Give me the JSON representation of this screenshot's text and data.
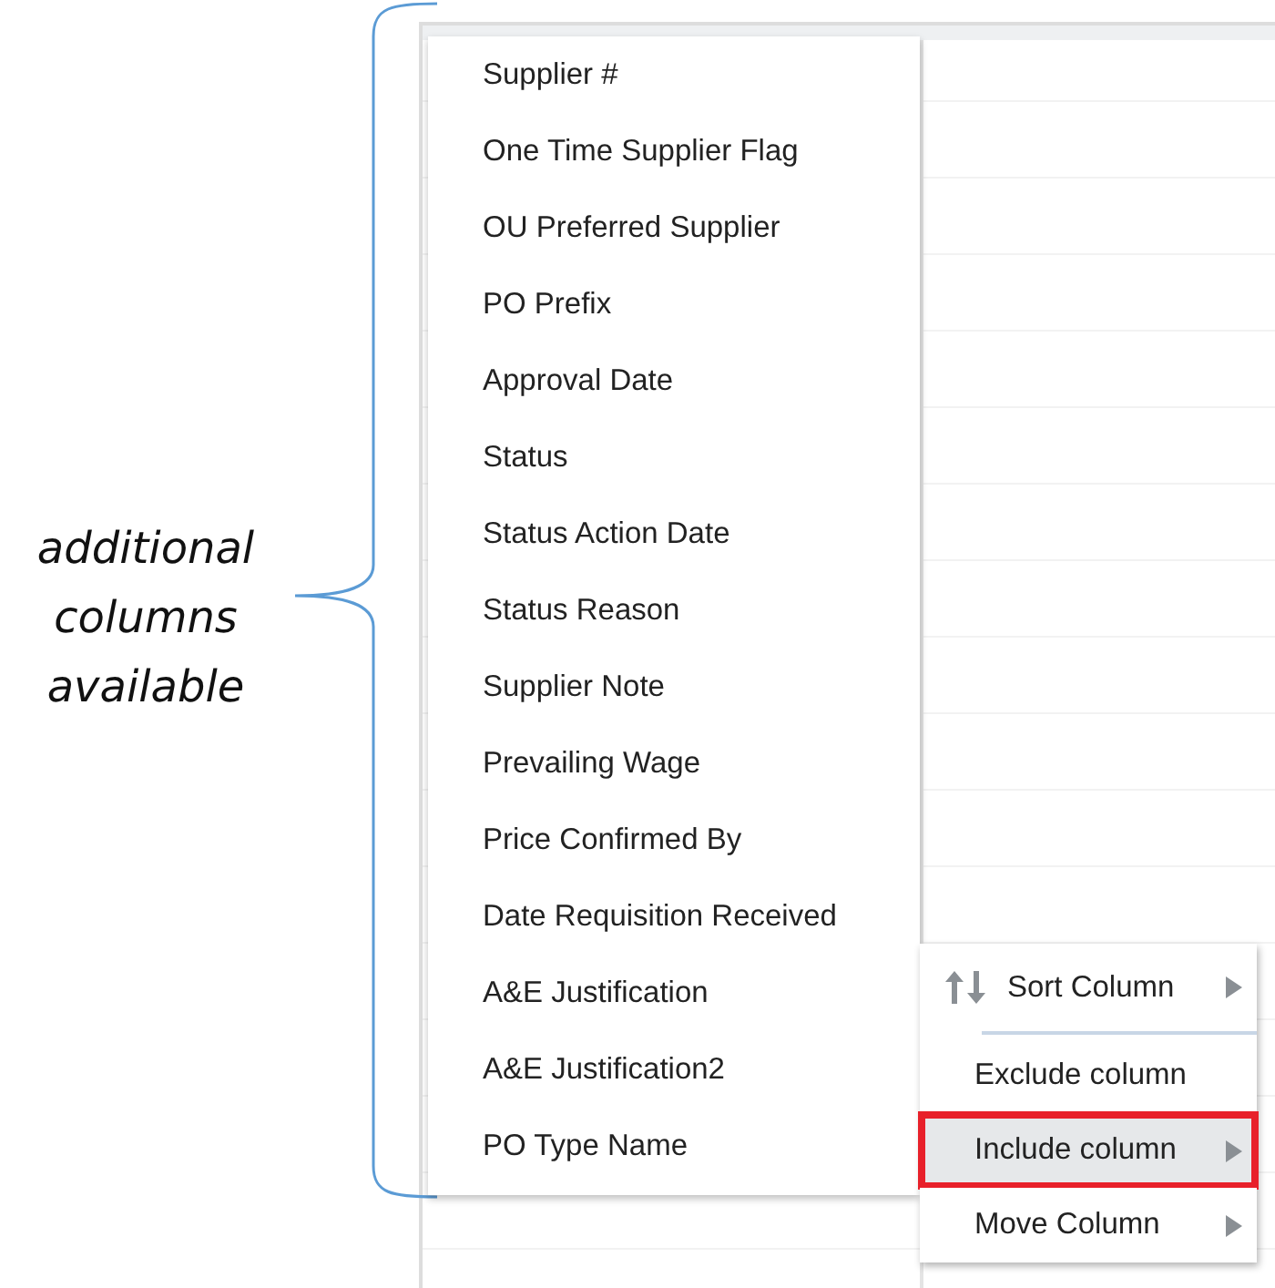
{
  "annotation": {
    "text": "additional columns available"
  },
  "column_list": {
    "items": [
      {
        "label": "Supplier #"
      },
      {
        "label": "One Time Supplier Flag"
      },
      {
        "label": "OU Preferred Supplier"
      },
      {
        "label": "PO Prefix"
      },
      {
        "label": "Approval Date"
      },
      {
        "label": "Status"
      },
      {
        "label": "Status Action Date"
      },
      {
        "label": "Status Reason"
      },
      {
        "label": "Supplier Note"
      },
      {
        "label": "Prevailing Wage"
      },
      {
        "label": "Price Confirmed By"
      },
      {
        "label": "Date Requisition Received"
      },
      {
        "label": "A&E Justification"
      },
      {
        "label": "A&E Justification2"
      },
      {
        "label": "PO Type Name"
      }
    ]
  },
  "context_menu": {
    "items": [
      {
        "kind": "sort",
        "label": "Sort Column",
        "submenu": true,
        "selected": false,
        "outlined": false
      },
      {
        "kind": "plain",
        "label": "Exclude column",
        "submenu": false,
        "selected": false,
        "outlined": false
      },
      {
        "kind": "plain",
        "label": "Include column",
        "submenu": true,
        "selected": true,
        "outlined": true
      },
      {
        "kind": "plain",
        "label": "Move Column",
        "submenu": true,
        "selected": false,
        "outlined": false
      }
    ]
  }
}
